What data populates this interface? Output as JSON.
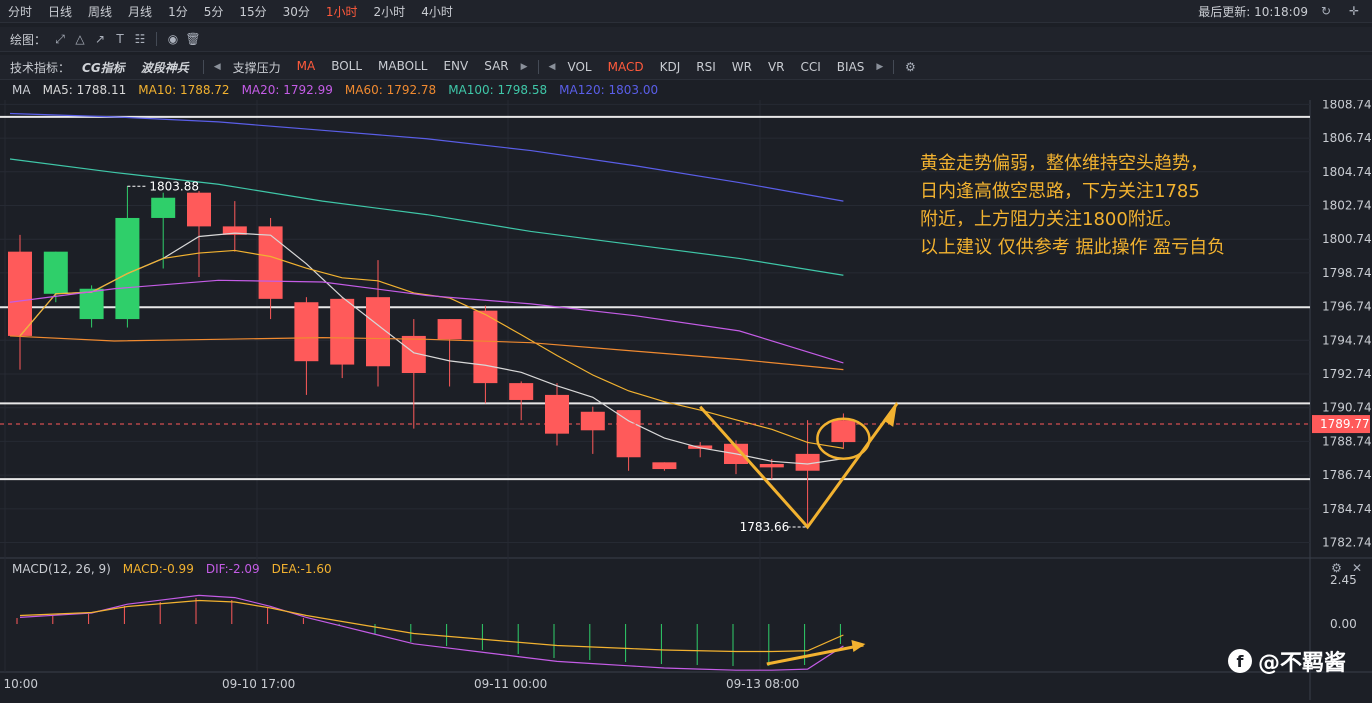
{
  "periods": [
    "分时",
    "日线",
    "周线",
    "月线",
    "1分",
    "5分",
    "15分",
    "30分",
    "1小时",
    "2小时",
    "4小时"
  ],
  "active_period": "1小时",
  "last_update": "最后更新: 10:18:09",
  "draw_label": "绘图：",
  "indicator_label": "技术指标：",
  "indicators_left": [
    "CG指标",
    "波段神兵"
  ],
  "indicators_main": [
    "支撑压力",
    "MA",
    "BOLL",
    "MABOLL",
    "ENV",
    "SAR"
  ],
  "indicators_sub": [
    "VOL",
    "MACD",
    "KDJ",
    "RSI",
    "WR",
    "VR",
    "CCI",
    "BIAS"
  ],
  "active_main": "MA",
  "active_sub": "MACD",
  "ma_legend": {
    "title": "MA",
    "items": [
      {
        "label": "MA5: 1788.11",
        "color": "#d8d8d8"
      },
      {
        "label": "MA10: 1788.72",
        "color": "#f2b230"
      },
      {
        "label": "MA20: 1792.99",
        "color": "#c45ce6"
      },
      {
        "label": "MA60: 1792.78",
        "color": "#f08a30"
      },
      {
        "label": "MA100: 1798.58",
        "color": "#3fc7a8"
      },
      {
        "label": "MA120: 1803.00",
        "color": "#5a5ee8"
      }
    ]
  },
  "macd_legend": {
    "title": "MACD(12, 26, 9)",
    "macd": "MACD:-0.99",
    "dif": "DIF:-2.09",
    "dea": "DEA:-1.60"
  },
  "price_axis": [
    "1808.74",
    "1806.74",
    "1804.74",
    "1802.74",
    "1800.74",
    "1798.74",
    "1796.74",
    "1794.74",
    "1792.74",
    "1790.74",
    "1788.74",
    "1786.74",
    "1784.74",
    "1782.74"
  ],
  "current_price": "1789.77",
  "macd_axis": [
    "2.45",
    "0.00"
  ],
  "time_axis": [
    "0 10:00",
    "09-10 17:00",
    "09-11 00:00",
    "09-13 08:00"
  ],
  "high_label": "1803.88",
  "low_label": "1783.66",
  "annotation": [
    "黄金走势偏弱，整体维持空头趋势，",
    "日内逢高做空思路，下方关注1785",
    "附近，上方阻力关注1800附近。",
    "以上建议 仅供参考 据此操作 盈亏自负"
  ],
  "watermark": "@不羁酱",
  "colors": {
    "up": "#ff5a5a",
    "down": "#2fcf6a",
    "annotation": "#f2b230",
    "level_line": "#e8e8e8"
  },
  "chart_data": {
    "type": "candlestick",
    "ylim": [
      1782,
      1809
    ],
    "levels": [
      1808.0,
      1796.7,
      1791.0,
      1786.5
    ],
    "candles": [
      {
        "o": 1800.0,
        "h": 1801.0,
        "c": 1795.0,
        "l": 1793.0
      },
      {
        "o": 1797.5,
        "h": 1800.0,
        "c": 1800.0,
        "l": 1797.0
      },
      {
        "o": 1796.0,
        "h": 1798.0,
        "c": 1797.8,
        "l": 1795.5
      },
      {
        "o": 1796.0,
        "h": 1803.88,
        "c": 1802.0,
        "l": 1795.5
      },
      {
        "o": 1802.0,
        "h": 1803.5,
        "c": 1803.2,
        "l": 1799.0
      },
      {
        "o": 1803.5,
        "h": 1803.6,
        "c": 1801.5,
        "l": 1798.5
      },
      {
        "o": 1801.5,
        "h": 1803.0,
        "c": 1801.0,
        "l": 1800.0
      },
      {
        "o": 1801.5,
        "h": 1802.0,
        "c": 1797.2,
        "l": 1796.0
      },
      {
        "o": 1797.0,
        "h": 1797.3,
        "c": 1793.5,
        "l": 1791.5
      },
      {
        "o": 1797.2,
        "h": 1797.3,
        "c": 1793.3,
        "l": 1792.5
      },
      {
        "o": 1797.3,
        "h": 1799.5,
        "c": 1793.2,
        "l": 1792.0
      },
      {
        "o": 1795.0,
        "h": 1796.0,
        "c": 1792.8,
        "l": 1789.5
      },
      {
        "o": 1796.0,
        "h": 1796.0,
        "c": 1794.8,
        "l": 1792.0
      },
      {
        "o": 1796.5,
        "h": 1796.8,
        "c": 1792.2,
        "l": 1791.0
      },
      {
        "o": 1792.2,
        "h": 1792.3,
        "c": 1791.2,
        "l": 1790.0
      },
      {
        "o": 1791.5,
        "h": 1792.2,
        "c": 1789.2,
        "l": 1788.5
      },
      {
        "o": 1790.5,
        "h": 1790.8,
        "c": 1789.4,
        "l": 1788.0
      },
      {
        "o": 1790.6,
        "h": 1790.6,
        "c": 1787.8,
        "l": 1787.0
      },
      {
        "o": 1787.5,
        "h": 1787.5,
        "c": 1787.1,
        "l": 1787.0
      },
      {
        "o": 1788.5,
        "h": 1788.7,
        "c": 1788.3,
        "l": 1787.8
      },
      {
        "o": 1788.6,
        "h": 1788.8,
        "c": 1787.4,
        "l": 1786.8
      },
      {
        "o": 1787.4,
        "h": 1787.7,
        "c": 1787.2,
        "l": 1786.5
      },
      {
        "o": 1788.0,
        "h": 1790.0,
        "c": 1787.0,
        "l": 1783.66
      },
      {
        "o": 1790.0,
        "h": 1790.4,
        "c": 1788.7,
        "l": 1788.3
      }
    ],
    "macd": [
      0.3,
      0.4,
      0.5,
      0.9,
      1.1,
      1.3,
      1.2,
      0.8,
      0.3,
      -0.1,
      -0.5,
      -0.9,
      -1.1,
      -1.3,
      -1.5,
      -1.7,
      -1.8,
      -1.9,
      -2.0,
      -2.05,
      -2.1,
      -2.1,
      -2.05,
      -1.0
    ]
  }
}
